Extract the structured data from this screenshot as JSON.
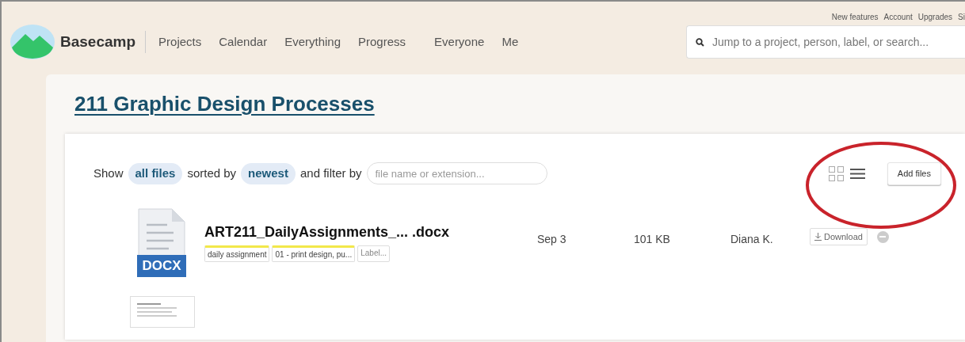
{
  "top_links": [
    "New features",
    "Account",
    "Upgrades",
    "Si"
  ],
  "brand": "Basecamp",
  "nav": [
    {
      "label": "Projects"
    },
    {
      "label": "Calendar"
    },
    {
      "label": "Everything"
    },
    {
      "label": "Progress"
    },
    {
      "label": "Everyone"
    },
    {
      "label": "Me"
    }
  ],
  "search": {
    "placeholder": "Jump to a project, person, label, or search..."
  },
  "project_title": "211 Graphic Design Processes",
  "toolbar": {
    "show_label": "Show",
    "file_scope": "all files",
    "sorted_label": "sorted by",
    "sort": "newest",
    "filter_label": "and filter by",
    "filter": {
      "placeholder": "file name or extension..."
    },
    "add_button": "Add files"
  },
  "files": [
    {
      "kind": "docx",
      "type_label": "DOCX",
      "name": "ART211_DailyAssignments_... .docx",
      "labels": [
        {
          "text": "daily assignment",
          "color": "#f2e84a"
        },
        {
          "text": "01 - print design, pu...",
          "color": "#f2e84a"
        },
        {
          "text": "Label..."
        }
      ],
      "date": "Sep 3",
      "size": "101 KB",
      "owner": "Diana K.",
      "download": "Download"
    },
    {
      "kind": "pdf"
    }
  ]
}
